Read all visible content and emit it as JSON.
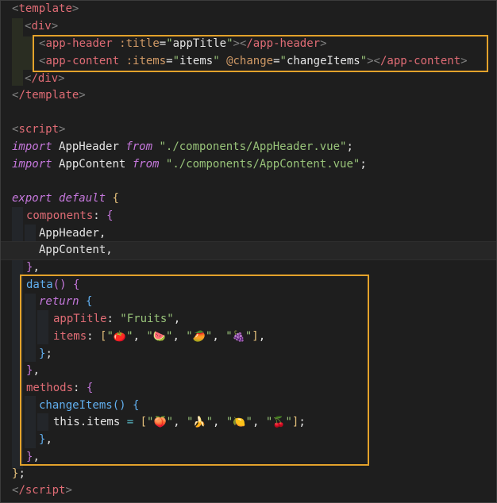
{
  "code": {
    "template_open": "template",
    "div_open": "div",
    "app_header_tag": "app-header",
    "title_attr": ":title",
    "title_val": "appTitle",
    "app_content_tag": "app-content",
    "items_attr": ":items",
    "items_val": "items",
    "change_attr": "@change",
    "change_val": "changeItems",
    "div_close": "/div",
    "template_close": "/template",
    "script_open": "script",
    "import_kw": "import",
    "from_kw": "from",
    "header_import_name": "AppHeader",
    "header_import_path": "\"./components/AppHeader.vue\"",
    "content_import_name": "AppContent",
    "content_import_path": "\"./components/AppContent.vue\"",
    "export_kw": "export",
    "default_kw": "default",
    "components_key": "components",
    "comp_1": "AppHeader,",
    "comp_2": "AppContent,",
    "data_fn": "data",
    "return_kw": "return",
    "app_title_key": "appTitle",
    "app_title_value": "\"Fruits\"",
    "items_key": "items",
    "fruits": [
      "🍅",
      "🍉",
      "🥭",
      "🍇"
    ],
    "methods_key": "methods",
    "change_fn": "changeItems",
    "this_kw": "this",
    "this_items": ".items",
    "fruits2": [
      "🍑",
      "🍌",
      "🍋",
      "🍒"
    ],
    "script_close": "/script"
  },
  "colors": {
    "highlight_border": "#e3a22b",
    "background": "#1e1e1e"
  }
}
